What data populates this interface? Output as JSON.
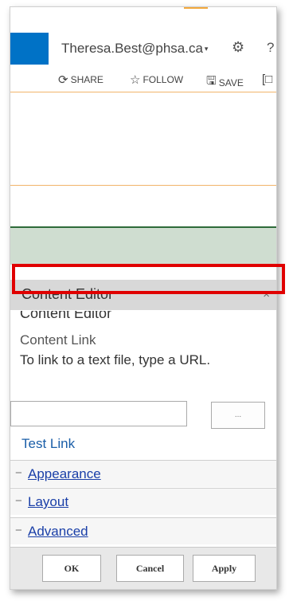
{
  "header": {
    "user": "Theresa.Best@phsa.ca",
    "user_caret": "▾",
    "settings_glyph": "⚙",
    "help_glyph": "?"
  },
  "actions": {
    "share": "SHARE",
    "follow": "FOLLOW",
    "save": "SAVE",
    "share_icon": "⟳",
    "follow_icon": "☆",
    "save_icon": "🖫",
    "focus_icon": "[□"
  },
  "panel": {
    "title": "Content Editor",
    "close": "×",
    "subtitle": "Content Editor",
    "content_link_label": "Content Link",
    "hint": "To link to a text file, type a URL.",
    "url_value": "",
    "builder_label": "...",
    "test_link": "Test Link",
    "sections": [
      {
        "toggle": "−",
        "label": "Appearance"
      },
      {
        "toggle": "−",
        "label": "Layout"
      },
      {
        "toggle": "−",
        "label": "Advanced"
      }
    ]
  },
  "buttons": {
    "ok": "OK",
    "cancel": "Cancel",
    "apply": "Apply"
  },
  "colors": {
    "brand_blue": "#0072c6",
    "accent_orange": "#f2b46a",
    "green_band": "#cfddd0",
    "highlight_red": "#e00000",
    "link_blue": "#1a3fa8"
  }
}
